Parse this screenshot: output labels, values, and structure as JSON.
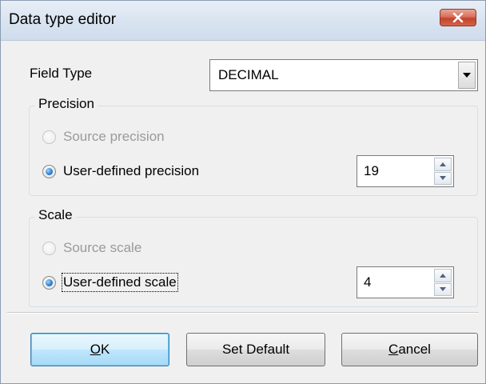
{
  "window": {
    "title": "Data type editor",
    "close_icon": "close-x-icon"
  },
  "field_type": {
    "label": "Field Type",
    "value": "DECIMAL"
  },
  "precision": {
    "group_title": "Precision",
    "source_label": "Source precision",
    "source_selected": false,
    "source_enabled": false,
    "user_label": "User-defined precision",
    "user_selected": true,
    "user_value": "19"
  },
  "scale": {
    "group_title": "Scale",
    "source_label": "Source scale",
    "source_selected": false,
    "source_enabled": false,
    "user_label": "User-defined scale",
    "user_selected": true,
    "user_value": "4"
  },
  "buttons": {
    "ok_mnemonic": "O",
    "ok_rest": "K",
    "set_default": "Set Default",
    "cancel_mnemonic": "C",
    "cancel_rest": "ancel"
  },
  "colors": {
    "accent": "#3c7fb1",
    "close_red": "#c2442b",
    "disabled_text": "#9a9a9a"
  }
}
